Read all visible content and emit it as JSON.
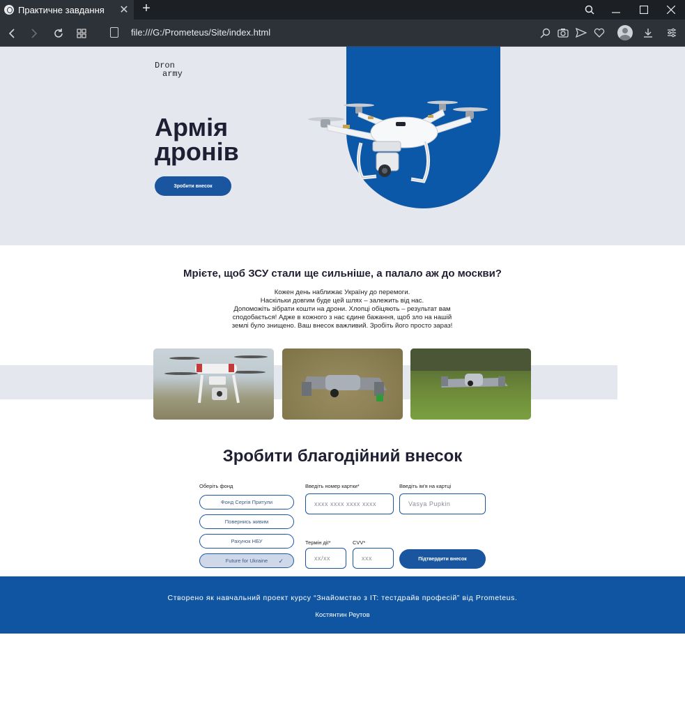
{
  "browser": {
    "tab_title": "Практичне завдання",
    "url": "file:///G:/Prometeus/Site/index.html"
  },
  "hero": {
    "logo_line1": "Dron",
    "logo_line2": "army",
    "title": "Армія дронів",
    "button": "Зробити внесок"
  },
  "intro": {
    "title": "Мрієте, щоб ЗСУ стали ще сильніше, а палало аж до москви?",
    "lines": [
      "Кожен день наближає Україну до перемоги.",
      "Наскільки довгим буде цей шлях – залежить від нас.",
      "Допоможіть зібрати кошти на дрони. Хлопці обіцяють – результат вам",
      "сподобається! Адже в кожного з нас єдине бажання, щоб зло на нашій",
      "землі було знищено. Ваш внесок важливий. Зробіть його просто зараз!"
    ]
  },
  "donate": {
    "title": "Зробити благодійний внесок",
    "fund_label": "Оберіть фонд",
    "funds": [
      "Фонд Сергія Притули",
      "Повернись живим",
      "Рахунок НБУ",
      "Future for Ukraine"
    ],
    "selected_fund": "Future for Ukraine",
    "card_number_label": "Введіть номер картки*",
    "card_number_placeholder": "xxxx xxxx xxxx xxxx",
    "card_name_label": "Введіть ім'я на картці",
    "card_name_placeholder": "Vasya Pupkin",
    "expiry_label": "Термін дії*",
    "expiry_placeholder": "xx/xx",
    "cvv_label": "CVV*",
    "cvv_placeholder": "xxx",
    "submit": "Підтвердити внесок"
  },
  "footer": {
    "text": "Створено як навчальний проект курсу “Знайомство з IT: тестдрайв професій” від Prometeus.",
    "author": "Костянтин Реутов"
  },
  "colors": {
    "primary": "#1a56a0",
    "hero_bg": "#e5e7ef",
    "footer_bg": "#0f55a1"
  }
}
